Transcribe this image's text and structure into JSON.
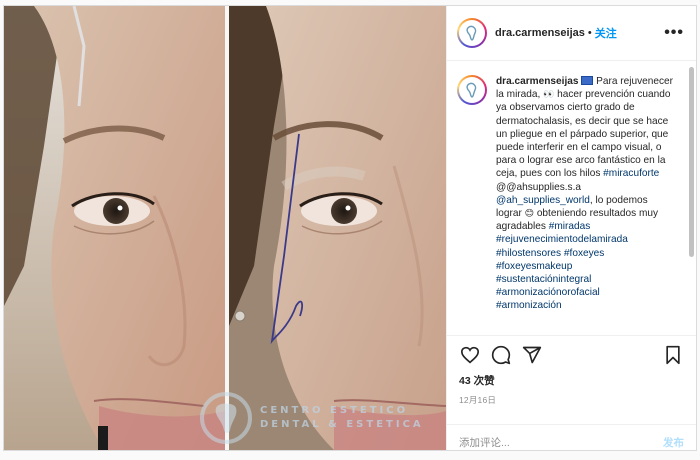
{
  "post": {
    "author": "dra.carmenseijas",
    "follow_label": "关注",
    "separator": "•",
    "more_label": "•••"
  },
  "caption": {
    "username": "dra.carmenseijas",
    "seg1": " Para rejuvenecer la mirada, ",
    "seg2": " hacer prevención cuando ya observamos cierto grado de dermatochalasis, es decir que se hace un pliegue en el párpado superior, que puede interferir en el campo visual, o para o lograr ese arco fantástico en la ceja, pues con los hilos ",
    "tag1": "#miracuforte",
    "seg3": " @@ahsupplies.s.a ",
    "mention1": "@ah_supplies_world",
    "seg4": ", lo podemos lograr ",
    "seg5": " obteniendo resultados muy agradables ",
    "tag2": "#miradas",
    "tag3": "#rejuvenecimientodelamirada",
    "tag4": "#hilostensores",
    "tag5": "#foxeyes",
    "tag6": "#foxeyesmakeup",
    "tag7": "#sustentaciónintegral",
    "tag8": "#armonizaciónorofacial",
    "tag9": "#armonización"
  },
  "engagement": {
    "likes": "43 次赞",
    "date": "12月16日"
  },
  "comment_input": {
    "placeholder": "添加评论...",
    "post_label": "发布"
  },
  "image": {
    "watermark_line1": "CENTRO ESTETICO",
    "watermark_line2": "DENTAL & ESTETICA"
  },
  "colors": {
    "link": "#00376b",
    "follow": "#0095f6",
    "post_disabled": "#b2dffc",
    "muted": "#8e8e8e"
  },
  "icons": [
    "heart-icon",
    "comment-icon",
    "share-icon",
    "bookmark-icon",
    "more-icon",
    "avatar-logo-icon",
    "eyes-emoji-icon",
    "flag-icon",
    "smile-emoji-icon"
  ]
}
